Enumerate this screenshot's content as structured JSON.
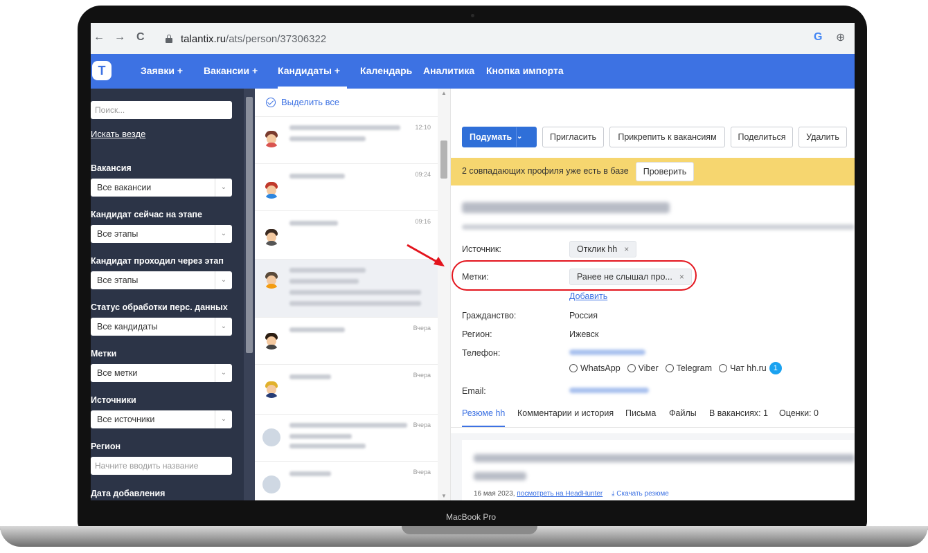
{
  "device_label": "MacBook Pro",
  "browser": {
    "url_host": "talantix.ru",
    "url_path": "/ats/person/37306322",
    "back": "←",
    "forward": "→",
    "reload": "C",
    "profile_letter": "G",
    "zoom_symbol": "⊕"
  },
  "app": {
    "logo_letter": "T",
    "nav": [
      {
        "label": "Заявки +"
      },
      {
        "label": "Вакансии +"
      },
      {
        "label": "Кандидаты +"
      },
      {
        "label": "Календарь"
      },
      {
        "label": "Аналитика"
      },
      {
        "label": "Кнопка импорта"
      }
    ],
    "active_nav": "Кандидаты +"
  },
  "sidebar": {
    "search_placeholder": "Поиск...",
    "search_everywhere": "Искать везде",
    "filters": [
      {
        "label": "Вакансия",
        "value": "Все вакансии"
      },
      {
        "label": "Кандидат сейчас на этапе",
        "value": "Все этапы"
      },
      {
        "label": "Кандидат проходил через этап",
        "value": "Все этапы"
      },
      {
        "label": "Статус обработки перс. данных",
        "value": "Все кандидаты"
      },
      {
        "label": "Метки",
        "value": "Все метки"
      },
      {
        "label": "Источники",
        "value": "Все источники"
      }
    ],
    "region_label": "Регион",
    "region_placeholder": "Начните вводить название",
    "date_label": "Дата добавления"
  },
  "candidate_list": {
    "select_all": "Выделить все",
    "items": [
      {
        "time": "12:10"
      },
      {
        "time": "09:24"
      },
      {
        "time": "09:16"
      },
      {
        "time": ""
      },
      {
        "time": "Вчера"
      },
      {
        "time": "Вчера"
      },
      {
        "time": "Вчера"
      },
      {
        "time": "Вчера"
      }
    ]
  },
  "detail": {
    "buttons": {
      "think": "Подумать",
      "invite": "Пригласить",
      "attach": "Прикрепить к вакансиям",
      "share": "Поделиться",
      "delete": "Удалить"
    },
    "banner": {
      "text": "2 совпадающих профиля уже есть в базе",
      "button": "Проверить"
    },
    "fields": {
      "source_label": "Источник:",
      "source_value": "Отклик hh",
      "tags_label": "Метки:",
      "tags_value": "Ранее не слышал про...",
      "add_link": "Добавить",
      "citizenship_label": "Гражданство:",
      "citizenship_value": "Россия",
      "region_label": "Регион:",
      "region_value": "Ижевск",
      "phone_label": "Телефон:",
      "email_label": "Email:"
    },
    "messengers": {
      "whatsapp": "WhatsApp",
      "viber": "Viber",
      "telegram": "Telegram",
      "hh_chat": "Чат hh.ru",
      "hh_badge": "1"
    },
    "tabs": [
      "Резюме hh",
      "Комментарии и история",
      "Письма",
      "Файлы",
      "В вакансиях: 1",
      "Оценки: 0"
    ],
    "resume": {
      "date": "16 мая 2023,",
      "view_link": "посмотреть на HeadHunter",
      "download": "Скачать резюме"
    }
  },
  "annotation": {
    "color": "#e3141d"
  }
}
